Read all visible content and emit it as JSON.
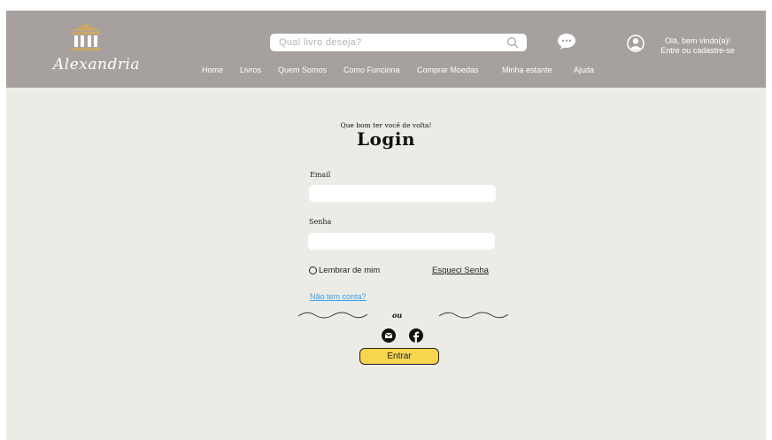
{
  "header": {
    "brand": "Alexandria",
    "search_placeholder": "Qual livro deseja?",
    "greeting_line1": "Olá, bem vindo(a)!",
    "greeting_line2": "Entre ou cadastre-se",
    "nav": [
      "Home",
      "Livros",
      "Quem Somos",
      "Como Funciona",
      "Comprar Moedas",
      "Minha estante",
      "Ajuda"
    ]
  },
  "login": {
    "subtitle": "Que bom ter você de volta!",
    "title": "Login",
    "email_label": "Email",
    "email_value": "",
    "password_label": "Senha",
    "password_value": "",
    "remember_label": "Lembrar de mim",
    "forgot_label": "Esqueci Senha",
    "signup_link": "Não tem conta?",
    "divider_text": "ou",
    "submit_label": "Entrar"
  },
  "icons": [
    "building-logo-icon",
    "search-icon",
    "chat-icon",
    "user-icon",
    "email-icon",
    "facebook-icon"
  ],
  "colors": {
    "header_bg": "#a6a19e",
    "page_bg": "#ecebe6",
    "logo_gold": "#c9a86b",
    "button_yellow": "#f7d54e",
    "link_blue": "#3aa0e6"
  }
}
